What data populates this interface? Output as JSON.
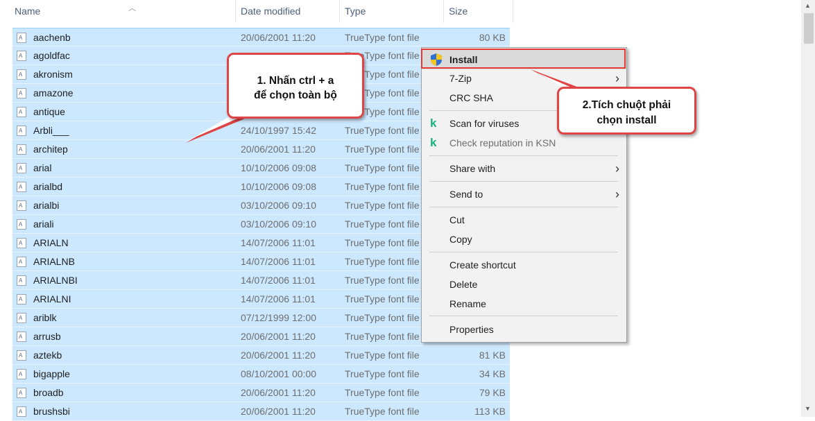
{
  "columns": {
    "name": "Name",
    "date": "Date modified",
    "type": "Type",
    "size": "Size"
  },
  "files": [
    {
      "name": "aachenb",
      "date": "20/06/2001 11:20",
      "type": "TrueType font file",
      "size": "80 KB"
    },
    {
      "name": "agoldfac",
      "date": "",
      "type": "TrueType font file",
      "size": ""
    },
    {
      "name": "akronism",
      "date": "",
      "type": "TrueType font file",
      "size": ""
    },
    {
      "name": "amazone",
      "date": "",
      "type": "TrueType font file",
      "size": ""
    },
    {
      "name": "antique",
      "date": "",
      "type": "TrueType font file",
      "size": ""
    },
    {
      "name": "Arbli___",
      "date": "24/10/1997 15:42",
      "type": "TrueType font file",
      "size": ""
    },
    {
      "name": "architep",
      "date": "20/06/2001 11:20",
      "type": "TrueType font file",
      "size": ""
    },
    {
      "name": "arial",
      "date": "10/10/2006 09:08",
      "type": "TrueType font file",
      "size": ""
    },
    {
      "name": "arialbd",
      "date": "10/10/2006 09:08",
      "type": "TrueType font file",
      "size": ""
    },
    {
      "name": "arialbi",
      "date": "03/10/2006 09:10",
      "type": "TrueType font file",
      "size": ""
    },
    {
      "name": "ariali",
      "date": "03/10/2006 09:10",
      "type": "TrueType font file",
      "size": ""
    },
    {
      "name": "ARIALN",
      "date": "14/07/2006 11:01",
      "type": "TrueType font file",
      "size": ""
    },
    {
      "name": "ARIALNB",
      "date": "14/07/2006 11:01",
      "type": "TrueType font file",
      "size": ""
    },
    {
      "name": "ARIALNBI",
      "date": "14/07/2006 11:01",
      "type": "TrueType font file",
      "size": ""
    },
    {
      "name": "ARIALNI",
      "date": "14/07/2006 11:01",
      "type": "TrueType font file",
      "size": ""
    },
    {
      "name": "ariblk",
      "date": "07/12/1999 12:00",
      "type": "TrueType font file",
      "size": ""
    },
    {
      "name": "arrusb",
      "date": "20/06/2001 11:20",
      "type": "TrueType font file",
      "size": ""
    },
    {
      "name": "aztekb",
      "date": "20/06/2001 11:20",
      "type": "TrueType font file",
      "size": "81 KB"
    },
    {
      "name": "bigapple",
      "date": "08/10/2001 00:00",
      "type": "TrueType font file",
      "size": "34 KB"
    },
    {
      "name": "broadb",
      "date": "20/06/2001 11:20",
      "type": "TrueType font file",
      "size": "79 KB"
    },
    {
      "name": "brushsbi",
      "date": "20/06/2001 11:20",
      "type": "TrueType font file",
      "size": "113 KB"
    }
  ],
  "context_menu": {
    "install": "Install",
    "seven_zip": "7-Zip",
    "crc_sha": "CRC SHA",
    "scan": "Scan for viruses",
    "check_reputation": "Check reputation in KSN",
    "share_with": "Share with",
    "send_to": "Send to",
    "cut": "Cut",
    "copy": "Copy",
    "create_shortcut": "Create shortcut",
    "delete": "Delete",
    "rename": "Rename",
    "properties": "Properties"
  },
  "callouts": {
    "step1_line1": "1. Nhấn ctrl + a",
    "step1_line2": "để chọn toàn bộ",
    "step2_line1": "2.Tích chuột phải",
    "step2_line2": "chọn install"
  },
  "colors": {
    "selection": "#cce8ff",
    "callout_border": "#e04545",
    "menu_bg": "#f2f2f2"
  }
}
